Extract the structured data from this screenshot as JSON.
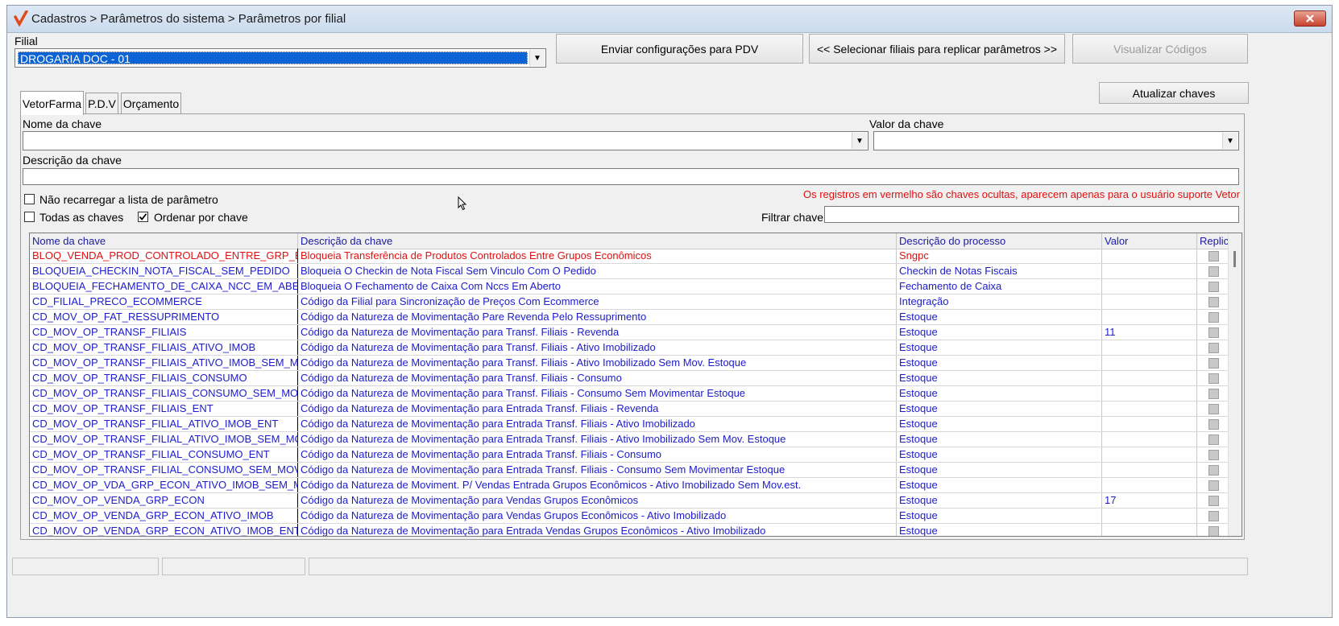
{
  "window": {
    "title": "Cadastros > Parâmetros do sistema > Parâmetros por filial",
    "app_icon": "checkmark-logo-icon",
    "close_icon": "close-icon"
  },
  "filial": {
    "label": "Filial",
    "value": "DROGARIA DOC - 01"
  },
  "buttons": {
    "enviar": "Enviar configurações para  PDV",
    "selecionar": "<< Selecionar filiais para replicar parâmetros >>",
    "visualizar": "Visualizar Códigos",
    "atualizar": "Atualizar chaves"
  },
  "tabs": [
    {
      "label": "VetorFarma",
      "active": true
    },
    {
      "label": "P.D.V",
      "active": false
    },
    {
      "label": "Orçamento",
      "active": false
    }
  ],
  "filters": {
    "nome_label": "Nome da chave",
    "nome_value": "",
    "valor_label": "Valor da chave",
    "valor_value": "",
    "descricao_label": "Descrição da chave",
    "descricao_value": "",
    "nao_recarregar_label": "Não recarregar a lista de parâmetro",
    "nao_recarregar_checked": false,
    "todas_label": "Todas as chaves",
    "todas_checked": false,
    "ordenar_label": "Ordenar por chave",
    "ordenar_checked": true,
    "filtrar_label": "Filtrar chave",
    "filtrar_value": "",
    "hidden_note": "Os registros em vermelho são chaves ocultas, aparecem apenas para o usuário suporte Vetor"
  },
  "grid": {
    "columns": [
      "Nome da chave",
      "Descrição  da chave",
      "Descrição do processo",
      "Valor",
      "Replic"
    ],
    "rows": [
      {
        "nome": "BLOQ_VENDA_PROD_CONTROLADO_ENTRE_GRP_ECON",
        "descricao": "Bloqueia Transferência de Produtos Controlados Entre Grupos Econômicos",
        "processo": "Sngpc",
        "valor": "",
        "hidden": true
      },
      {
        "nome": "BLOQUEIA_CHECKIN_NOTA_FISCAL_SEM_PEDIDO",
        "descricao": "Bloqueia O Checkin de Nota Fiscal Sem Vinculo Com O Pedido",
        "processo": "Checkin de Notas Fiscais",
        "valor": "",
        "hidden": false
      },
      {
        "nome": "BLOQUEIA_FECHAMENTO_DE_CAIXA_NCC_EM_ABERTO",
        "descricao": "Bloqueia O Fechamento de Caixa Com Nccs Em Aberto",
        "processo": "Fechamento de Caixa",
        "valor": "",
        "hidden": false
      },
      {
        "nome": "CD_FILIAL_PRECO_ECOMMERCE",
        "descricao": "Código da Filial para Sincronização de Preços Com Ecommerce",
        "processo": "Integração",
        "valor": "",
        "hidden": false
      },
      {
        "nome": "CD_MOV_OP_FAT_RESSUPRIMENTO",
        "descricao": "Código da Natureza de Movimentação Pare Revenda Pelo Ressuprimento",
        "processo": "Estoque",
        "valor": "",
        "hidden": false
      },
      {
        "nome": "CD_MOV_OP_TRANSF_FILIAIS",
        "descricao": "Código da Natureza de Movimentação para Transf. Filiais - Revenda",
        "processo": "Estoque",
        "valor": "11",
        "hidden": false
      },
      {
        "nome": "CD_MOV_OP_TRANSF_FILIAIS_ATIVO_IMOB",
        "descricao": "Código da Natureza de Movimentação para Transf. Filiais - Ativo Imobilizado",
        "processo": "Estoque",
        "valor": "",
        "hidden": false
      },
      {
        "nome": "CD_MOV_OP_TRANSF_FILIAIS_ATIVO_IMOB_SEM_MOV",
        "descricao": "Código da Natureza de Movimentação para Transf. Filiais - Ativo Imobilizado Sem Mov. Estoque",
        "processo": "Estoque",
        "valor": "",
        "hidden": false
      },
      {
        "nome": "CD_MOV_OP_TRANSF_FILIAIS_CONSUMO",
        "descricao": "Código da Natureza de Movimentação para Transf. Filiais - Consumo",
        "processo": "Estoque",
        "valor": "",
        "hidden": false
      },
      {
        "nome": "CD_MOV_OP_TRANSF_FILIAIS_CONSUMO_SEM_MOV",
        "descricao": "Código da Natureza de Movimentação para Transf. Filiais - Consumo Sem Movimentar Estoque",
        "processo": "Estoque",
        "valor": "",
        "hidden": false
      },
      {
        "nome": "CD_MOV_OP_TRANSF_FILIAIS_ENT",
        "descricao": "Código da Natureza de Movimentação para Entrada Transf. Filiais - Revenda",
        "processo": "Estoque",
        "valor": "",
        "hidden": false
      },
      {
        "nome": "CD_MOV_OP_TRANSF_FILIAL_ATIVO_IMOB_ENT",
        "descricao": "Código da Natureza de Movimentação para Entrada Transf. Filiais - Ativo Imobilizado",
        "processo": "Estoque",
        "valor": "",
        "hidden": false
      },
      {
        "nome": "CD_MOV_OP_TRANSF_FILIAL_ATIVO_IMOB_SEM_MOV",
        "descricao": "Código da Natureza de Movimentação para Entrada Transf. Filiais - Ativo Imobilizado Sem Mov. Estoque",
        "processo": "Estoque",
        "valor": "",
        "hidden": false
      },
      {
        "nome": "CD_MOV_OP_TRANSF_FILIAL_CONSUMO_ENT",
        "descricao": "Código da Natureza de Movimentação para Entrada Transf. Filiais - Consumo",
        "processo": "Estoque",
        "valor": "",
        "hidden": false
      },
      {
        "nome": "CD_MOV_OP_TRANSF_FILIAL_CONSUMO_SEM_MOV_",
        "descricao": "Código da Natureza de Movimentação para Entrada Transf. Filiais - Consumo Sem Movimentar Estoque",
        "processo": "Estoque",
        "valor": "",
        "hidden": false
      },
      {
        "nome": "CD_MOV_OP_VDA_GRP_ECON_ATIVO_IMOB_SEM_MOV",
        "descricao": "Código da Natureza de Moviment. P/ Vendas Entrada Grupos Econômicos - Ativo Imobilizado Sem Mov.est.",
        "processo": "Estoque",
        "valor": "",
        "hidden": false
      },
      {
        "nome": "CD_MOV_OP_VENDA_GRP_ECON",
        "descricao": "Código da Natureza de Movimentação para Vendas Grupos Econômicos",
        "processo": "Estoque",
        "valor": "17",
        "hidden": false
      },
      {
        "nome": "CD_MOV_OP_VENDA_GRP_ECON_ATIVO_IMOB",
        "descricao": "Código da Natureza de Movimentação para Vendas Grupos Econômicos - Ativo Imobilizado",
        "processo": "Estoque",
        "valor": "",
        "hidden": false
      },
      {
        "nome": "CD_MOV_OP_VENDA_GRP_ECON_ATIVO_IMOB_ENT",
        "descricao": "Código da Natureza de Movimentação para Entrada Vendas Grupos Econômicos - Ativo Imobilizado",
        "processo": "Estoque",
        "valor": "",
        "hidden": false
      }
    ]
  },
  "status_bar": {
    "panes": [
      "",
      "",
      ""
    ]
  },
  "colors": {
    "selection": "#0a64d6",
    "row_text": "#1c1ccc",
    "hidden_row_text": "#e01010"
  },
  "icons": {
    "dropdown": "chevron-down-icon",
    "cursor": "mouse-pointer-icon",
    "checkbox_check": "checkmark-icon"
  }
}
